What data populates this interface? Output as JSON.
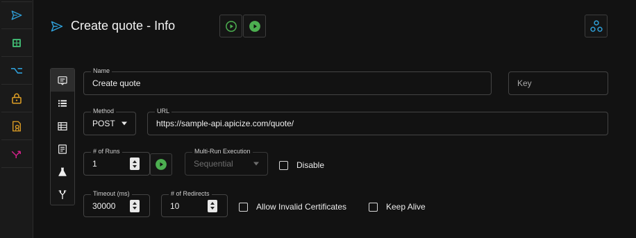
{
  "nav_rail": {
    "items": [
      {
        "icon": "send-icon",
        "color": "#2f9fd8"
      },
      {
        "icon": "grid-icon",
        "color": "#3fb36f"
      },
      {
        "icon": "route-icon",
        "color": "#2f9fd8"
      },
      {
        "icon": "lock-icon",
        "color": "#e2a125"
      },
      {
        "icon": "certificate-icon",
        "color": "#e2a125"
      },
      {
        "icon": "merge-icon",
        "color": "#d4208a"
      }
    ]
  },
  "header": {
    "title": "Create quote - Info",
    "title_icon": "send-icon",
    "run_button_icon": "play-outline-icon",
    "run_all_button_icon": "play-filled-icon",
    "workspace_button_icon": "hub-icon"
  },
  "subnav": {
    "items": [
      "info-icon",
      "list-icon",
      "table-icon",
      "document-icon",
      "flask-icon",
      "fork-icon"
    ],
    "active_index": 0
  },
  "form": {
    "name": {
      "label": "Name",
      "value": "Create quote"
    },
    "key": {
      "placeholder": "Key"
    },
    "method": {
      "label": "Method",
      "value": "POST"
    },
    "url": {
      "label": "URL",
      "value": "https://sample-api.apicize.com/quote/"
    },
    "runs": {
      "label": "# of Runs",
      "value": "1"
    },
    "multi_run": {
      "label": "Multi-Run Execution",
      "value": "Sequential"
    },
    "disable": {
      "label": "Disable",
      "checked": false
    },
    "timeout": {
      "label": "Timeout (ms)",
      "value": "30000"
    },
    "redirects": {
      "label": "# of Redirects",
      "value": "10"
    },
    "allow_invalid_certs": {
      "label": "Allow Invalid Certificates",
      "checked": false
    },
    "keep_alive": {
      "label": "Keep Alive",
      "checked": false
    }
  },
  "colors": {
    "accent_blue": "#2f9fd8",
    "accent_green": "#4caf50",
    "background": "#121212"
  }
}
